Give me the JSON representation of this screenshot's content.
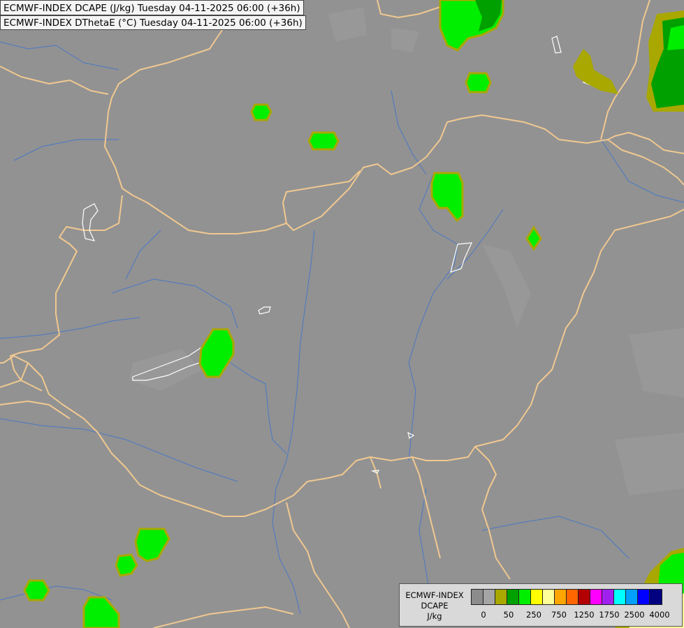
{
  "header": {
    "line1": "ECMWF-INDEX DCAPE (J/kg) Tuesday 04-11-2025 06:00 (+36h)",
    "line2": "ECMWF-INDEX DThetaE (°C) Tuesday 04-11-2025 06:00 (+36h)"
  },
  "legend": {
    "title_line1": "ECMWF-INDEX",
    "title_line2": "DCAPE",
    "title_line3": "J/kg",
    "swatch_colors": [
      "#8c8c8c",
      "#a5a5a5",
      "#a9a800",
      "#00a000",
      "#00ee00",
      "#ffff00",
      "#ffff99",
      "#ffa500",
      "#ff6600",
      "#b30000",
      "#ff00ff",
      "#a020f0",
      "#00ffff",
      "#00a0ff",
      "#0000ff",
      "#000080"
    ],
    "tick_labels": [
      "0",
      "50",
      "250",
      "750",
      "1250",
      "1750",
      "2500",
      "4000"
    ]
  },
  "colors": {
    "background": "#929292",
    "border": "#f0c890",
    "river": "#4a78c4",
    "lake": "#ffffff",
    "field_dark_green": "#00a000",
    "field_green": "#00ee00",
    "field_olive": "#a9a800",
    "field_yellow": "#ffff99"
  }
}
